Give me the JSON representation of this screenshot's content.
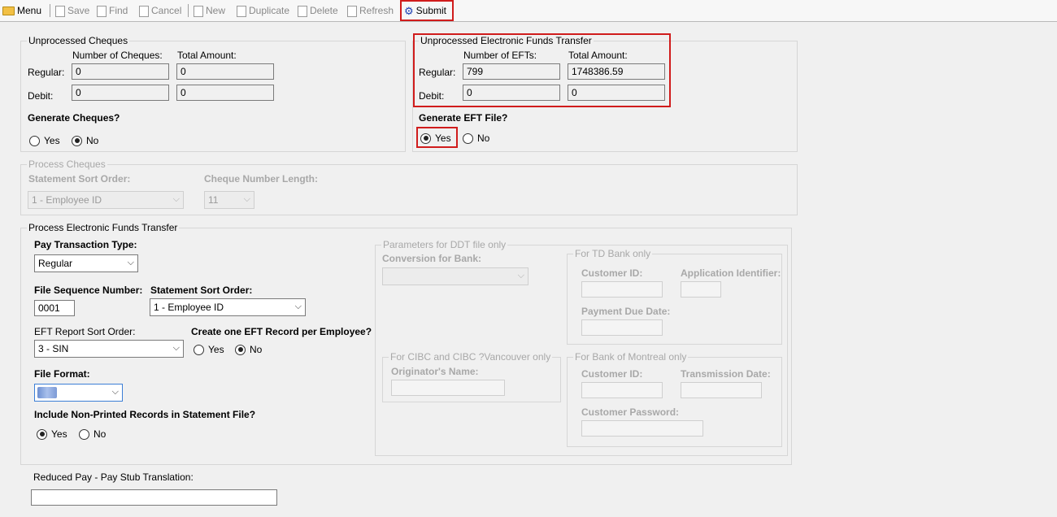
{
  "toolbar": {
    "menu": "Menu",
    "save": "Save",
    "find": "Find",
    "cancel": "Cancel",
    "new": "New",
    "duplicate": "Duplicate",
    "delete": "Delete",
    "refresh": "Refresh",
    "submit": "Submit"
  },
  "cheques": {
    "title": "Unprocessed Cheques",
    "col_count": "Number of Cheques:",
    "col_amount": "Total Amount:",
    "regular_label": "Regular:",
    "debit_label": "Debit:",
    "regular_count": "0",
    "regular_amount": "0",
    "debit_count": "0",
    "debit_amount": "0",
    "generate_label": "Generate Cheques?",
    "yes": "Yes",
    "no": "No",
    "selected": "No"
  },
  "eft": {
    "title": "Unprocessed Electronic Funds Transfer",
    "col_count": "Number of EFTs:",
    "col_amount": "Total Amount:",
    "regular_label": "Regular:",
    "debit_label": "Debit:",
    "regular_count": "799",
    "regular_amount": "1748386.59",
    "debit_count": "0",
    "debit_amount": "0",
    "generate_label": "Generate EFT File?",
    "yes": "Yes",
    "no": "No",
    "selected": "Yes"
  },
  "process_cheques": {
    "title": "Process Cheques",
    "sort_label": "Statement Sort Order:",
    "sort_value": "1 - Employee ID",
    "length_label": "Cheque Number Length:",
    "length_value": "11"
  },
  "process_eft": {
    "title": "Process Electronic Funds Transfer",
    "pay_type_label": "Pay Transaction Type:",
    "pay_type_value": "Regular",
    "file_seq_label": "File Sequence Number:",
    "file_seq_value": "0001",
    "stmt_sort_label": "Statement Sort Order:",
    "stmt_sort_value": "1 - Employee ID",
    "eft_report_label": "EFT Report Sort Order:",
    "eft_report_value": "3 - SIN",
    "one_record_label": "Create one EFT Record per Employee?",
    "one_record_yes": "Yes",
    "one_record_no": "No",
    "one_record_selected": "No",
    "file_format_label": "File Format:",
    "include_label": "Include Non-Printed Records in Statement File?",
    "include_yes": "Yes",
    "include_no": "No",
    "include_selected": "Yes"
  },
  "ddt": {
    "title": "Parameters for DDT file only",
    "conversion_label": "Conversion for Bank:"
  },
  "td": {
    "title": "For TD Bank only",
    "customer_id_label": "Customer ID:",
    "app_id_label": "Application Identifier:",
    "payment_due_label": "Payment Due Date:"
  },
  "cibc": {
    "title": "For CIBC and CIBC ?Vancouver only",
    "originator_label": "Originator's Name:"
  },
  "bmo": {
    "title": "For Bank of Montreal only",
    "customer_id_label": "Customer ID:",
    "transmission_label": "Transmission Date:",
    "password_label": "Customer Password:"
  },
  "reduced_pay": {
    "label": "Reduced Pay - Pay Stub Translation:",
    "value": ""
  },
  "colors": {
    "highlight": "#d01c1c",
    "window_bg": "#f0f0f0"
  }
}
